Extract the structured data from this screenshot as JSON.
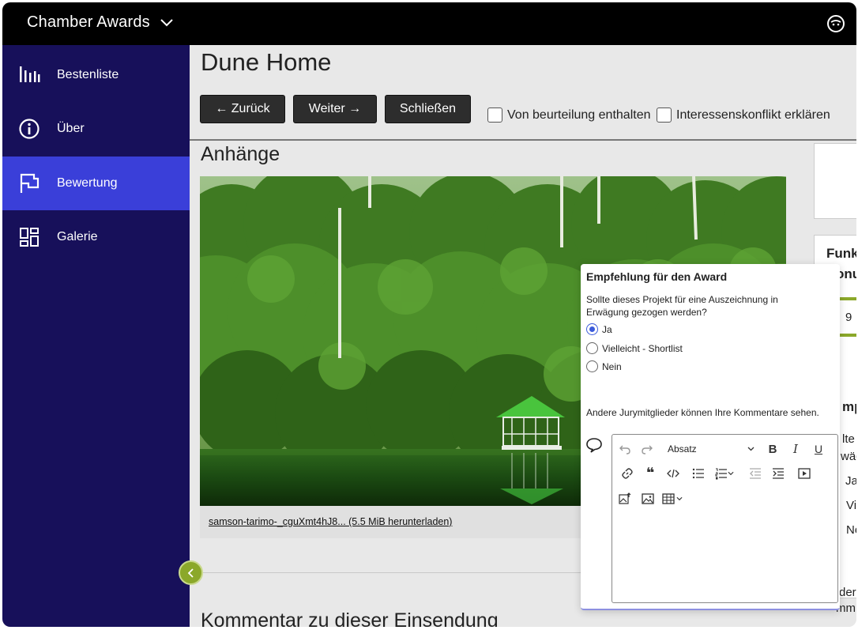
{
  "app": {
    "title": "Chamber Awards"
  },
  "sidebar": {
    "items": [
      {
        "label": "Bestenliste",
        "icon": "bar-chart-icon"
      },
      {
        "label": "Über",
        "icon": "info-icon"
      },
      {
        "label": "Bewertung",
        "icon": "flag-icon",
        "active": true
      },
      {
        "label": "Galerie",
        "icon": "grid-icon"
      }
    ]
  },
  "main": {
    "title": "Dune Home",
    "buttons": {
      "back": "← Zurück",
      "next": "Weiter →",
      "close": "Schließen"
    },
    "checkboxes": {
      "abstain": "Von beurteilung enthalten",
      "conflict": "Interessenskonflikt erklären"
    },
    "attachments_title": "Anhänge",
    "download_link": "samson-tarimo-_cguXmt4hJ8... (5.5 MiB herunterladen)",
    "comment_title": "Kommentar zu dieser Einsendung"
  },
  "right_panel": {
    "heading_line1": "Funk",
    "heading_line2": "onu",
    "score": "9",
    "heading2": "mpf",
    "lines": [
      "lte",
      "wäg",
      "Ja",
      "Vie",
      "Ne",
      "der",
      "mm"
    ]
  },
  "popup": {
    "title": "Empfehlung für den Award",
    "question": "Sollte dieses Projekt für eine Auszeichnung in Erwägung gezogen werden?",
    "options": [
      {
        "label": "Ja",
        "selected": true
      },
      {
        "label": "Vielleicht - Shortlist",
        "selected": false
      },
      {
        "label": "Nein",
        "selected": false
      }
    ],
    "note": "Andere Jurymitglieder können Ihre Kommentare sehen.",
    "editor": {
      "format": "Absatz"
    }
  },
  "colors": {
    "sidebar": "#17105a",
    "active": "#3a3fd9",
    "accent_green": "#8ba82a"
  }
}
